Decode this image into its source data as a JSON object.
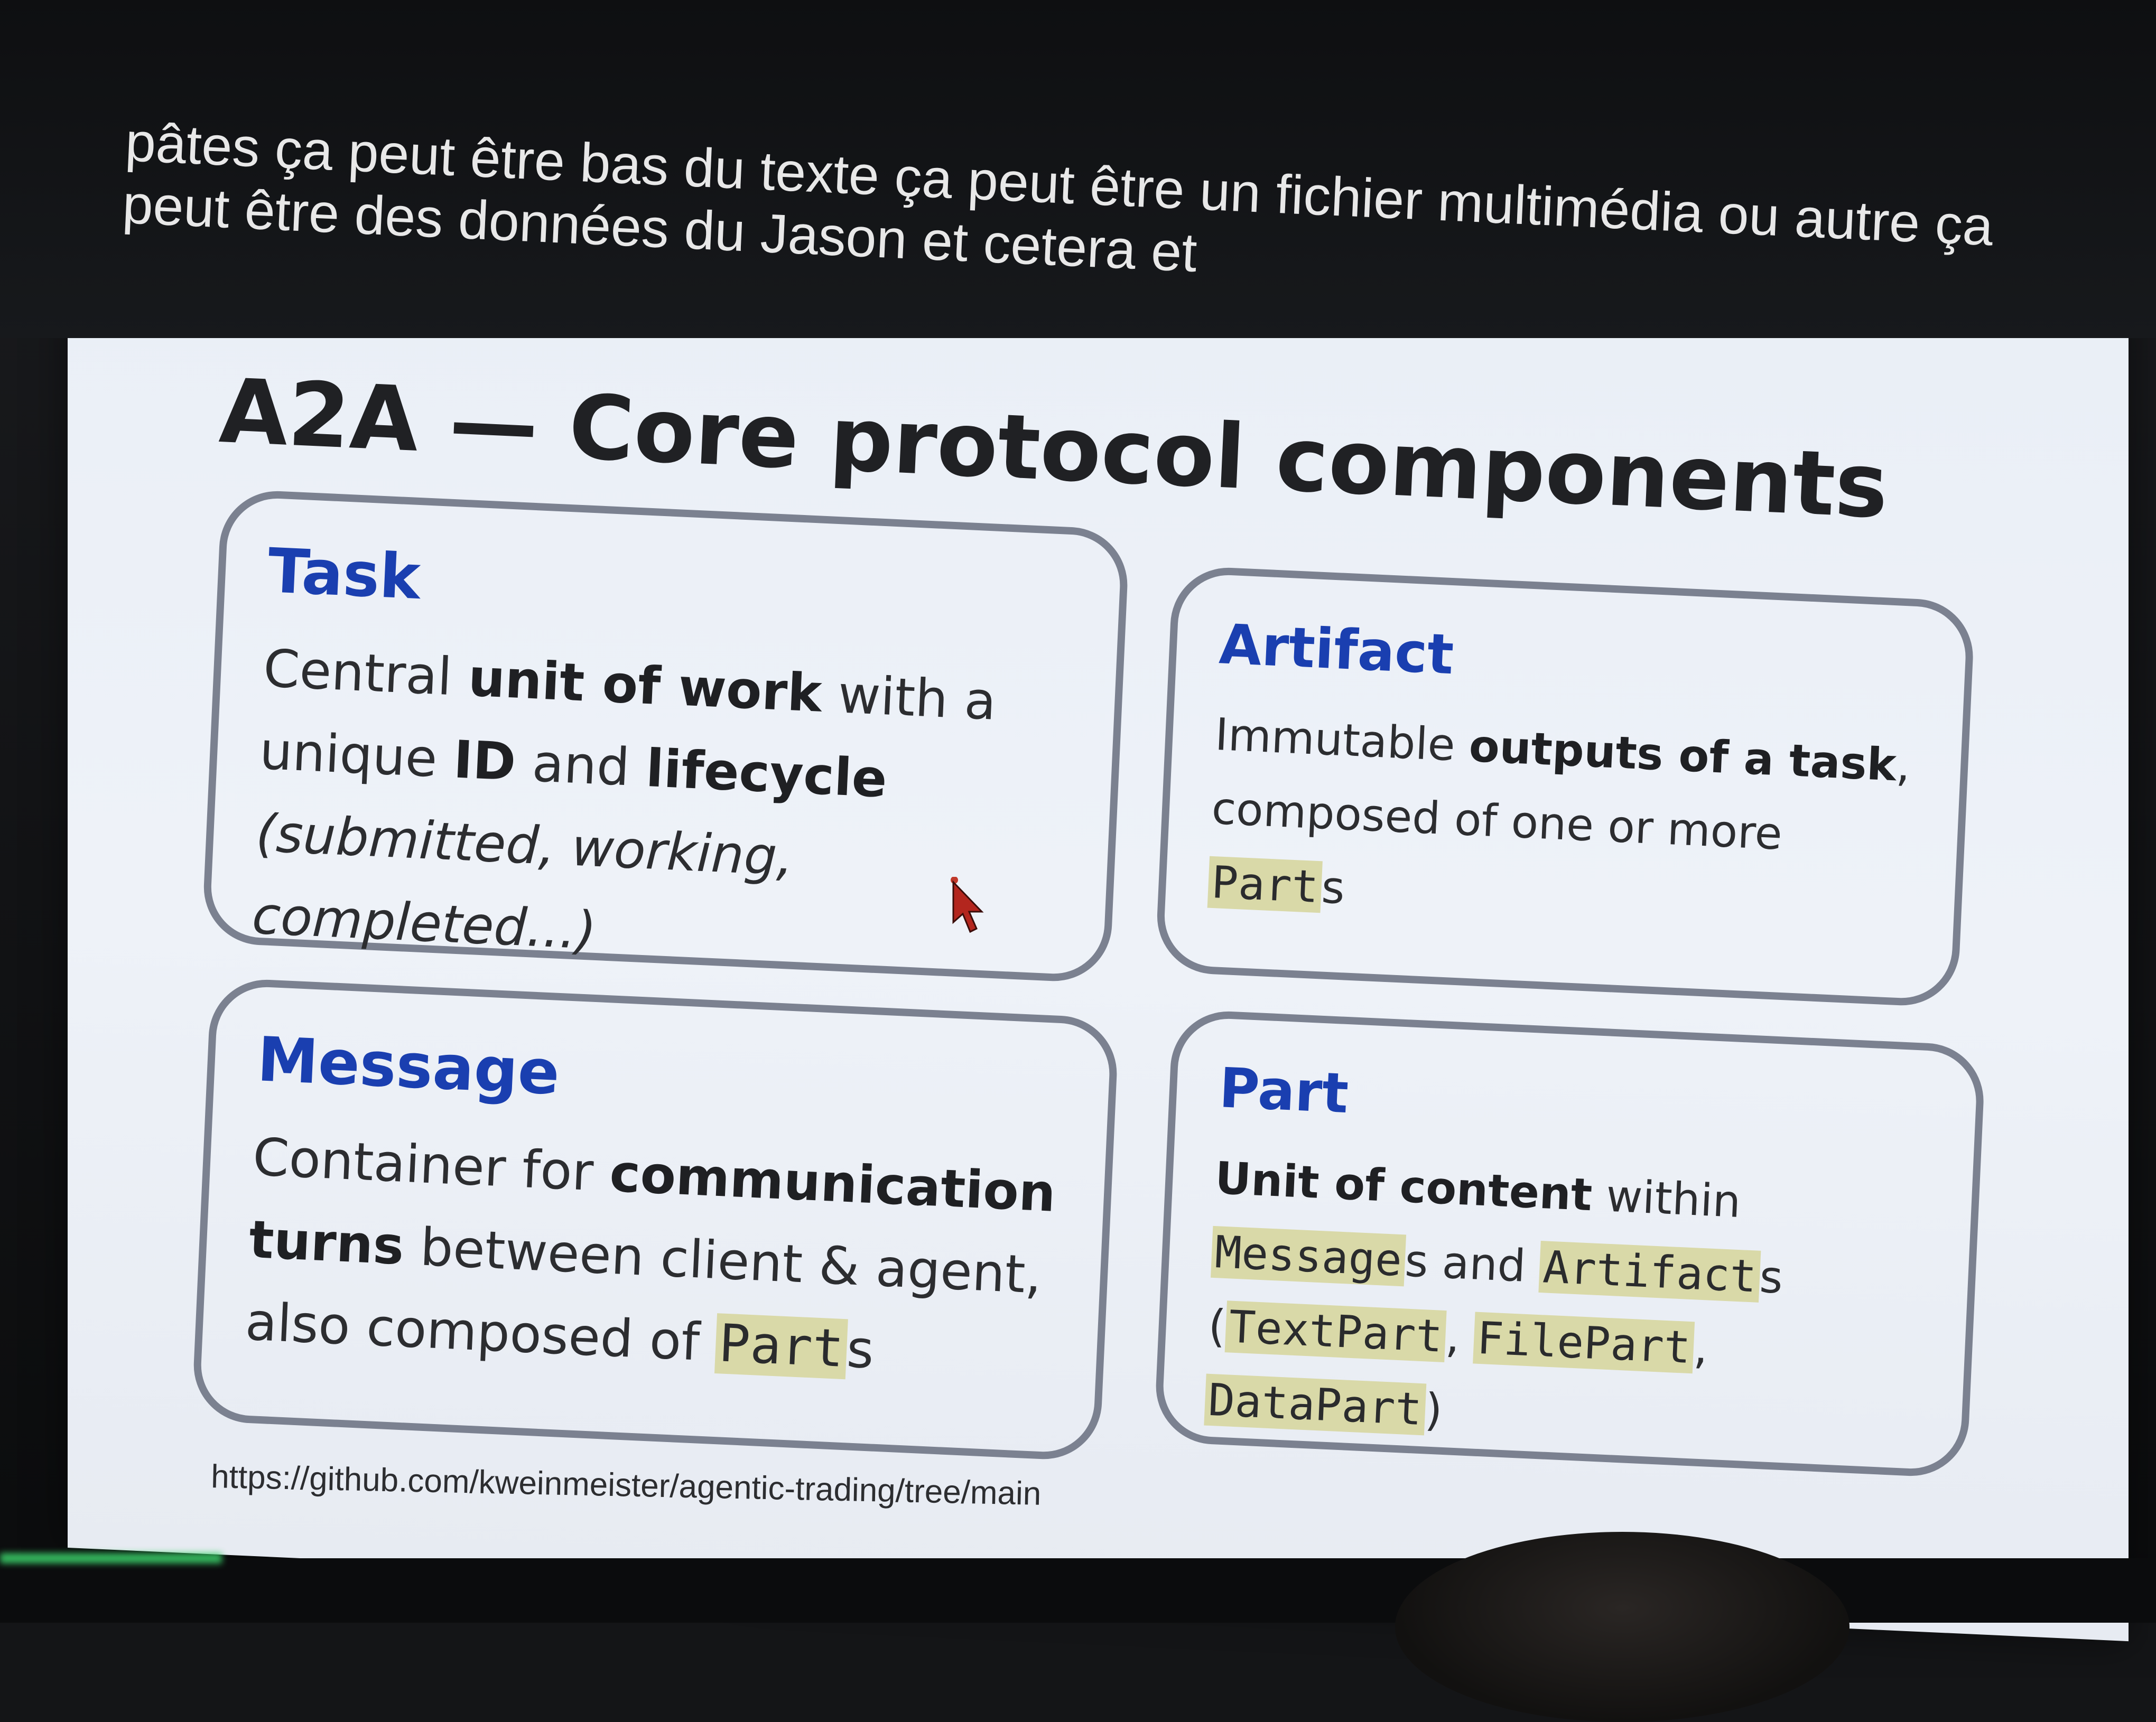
{
  "subtitle": {
    "text": "pâtes ça peut être bas du texte ça peut être un fichier multimédia ou autre ça peut être des données du Jason et cetera et"
  },
  "slide": {
    "title": "A2A — Core protocol components",
    "url": "https://github.com/kweinmeister/agentic-trading/tree/main",
    "cards": {
      "task": {
        "title": "Task",
        "t1": "Central ",
        "b1": "unit of work",
        "t2": " with a unique ",
        "b2": "ID",
        "t3": " and ",
        "b3": "lifecycle",
        "i1": "(submitted, working, completed...)"
      },
      "artifact": {
        "title": "Artifact",
        "t1": "Immutable ",
        "b1": "outputs of a task",
        "t2": ", composed of one or more ",
        "c1": "Part",
        "t3": "s"
      },
      "message": {
        "title": "Message",
        "t1": "Container for ",
        "b1": "communication turns",
        "t2": " between client & agent, also composed of ",
        "c1": "Part",
        "t3": "s"
      },
      "part": {
        "title": "Part",
        "b1": "Unit of content",
        "t1": " within ",
        "c1": "Message",
        "t2": "s and ",
        "c2": "Artifact",
        "t3": "s (",
        "c3": "TextPart",
        "t4": ", ",
        "c4": "FilePart",
        "t5": ", ",
        "c5": "DataPart",
        "t6": ")"
      }
    }
  },
  "colors": {
    "card_title": "#1a3fb0",
    "code_highlight": "#d9d9a8",
    "card_border": "#7b8190"
  },
  "icons": [
    "mouse-cursor-icon"
  ]
}
